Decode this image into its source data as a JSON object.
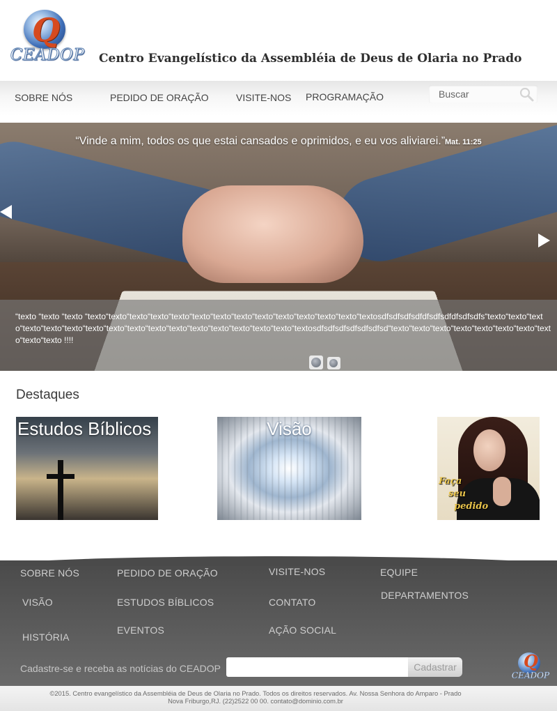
{
  "header": {
    "logo_text": "CEADOP",
    "logo_letter": "Q",
    "site_title": "Centro Evangelístico da Assembléia de Deus de Olaria no Prado"
  },
  "nav": {
    "items": [
      "SOBRE NÓS",
      "PEDIDO DE ORAÇÃO",
      "VISITE-NOS",
      "PROGRAMAÇÃO"
    ],
    "search_placeholder": "Buscar"
  },
  "slider": {
    "quote": "“Vinde a mim, todos os que estai cansados e oprimidos, e eu vos aliviarei.”",
    "quote_ref": "Mat. 11:25",
    "caption": "“texto “texto “texto “texto“texto“texto“texto“texto“texto“texto“texto“texto“texto“texto“texto“texto“textosdfsdfsdfsdfdfsdfsdfdfsdfsdfs“texto“texto“texto“texto“texto“texto“texto“texto“texto“texto“texto“texto“texto“texto“texto“texto“textosdfsdfsdfsdfsdfsdfsd“texto“texto“texto“texto“texto“texto“texto“texto“texto“texto  !!!!",
    "active_slide": 1,
    "slide_count": 2
  },
  "destaques": {
    "title": "Destaques",
    "cards": [
      {
        "label": "Estudos Bíblicos"
      },
      {
        "label": "Visão"
      },
      {
        "label": "",
        "image_text": [
          "Faça",
          "seu",
          "pedido"
        ]
      }
    ]
  },
  "footer": {
    "col1": [
      "SOBRE NÓS",
      "VISÃO",
      "HISTÓRIA"
    ],
    "col2": [
      "PEDIDO DE ORAÇÃO",
      "ESTUDOS BÍBLICOS",
      "EVENTOS"
    ],
    "col3": [
      "VISITE-NOS",
      "CONTATO",
      "AÇÃO SOCIAL"
    ],
    "col4": [
      "EQUIPE",
      "DEPARTAMENTOS"
    ],
    "newsletter_label": "Cadastre-se e receba as notícias do CEADOP",
    "newsletter_value": "",
    "newsletter_button": "Cadastrar",
    "logo_text": "CEADOP",
    "logo_letter": "Q"
  },
  "copyright": {
    "line1": "©2015. Centro evangelístico da Assembléia de Deus de Olaria no Prado. Todos os direitos reservados. Av. Nossa Senhora do Amparo - Prado",
    "line2": "Nova Friburgo,RJ. (22)2522 00 00. contato@dominio.com.br"
  }
}
